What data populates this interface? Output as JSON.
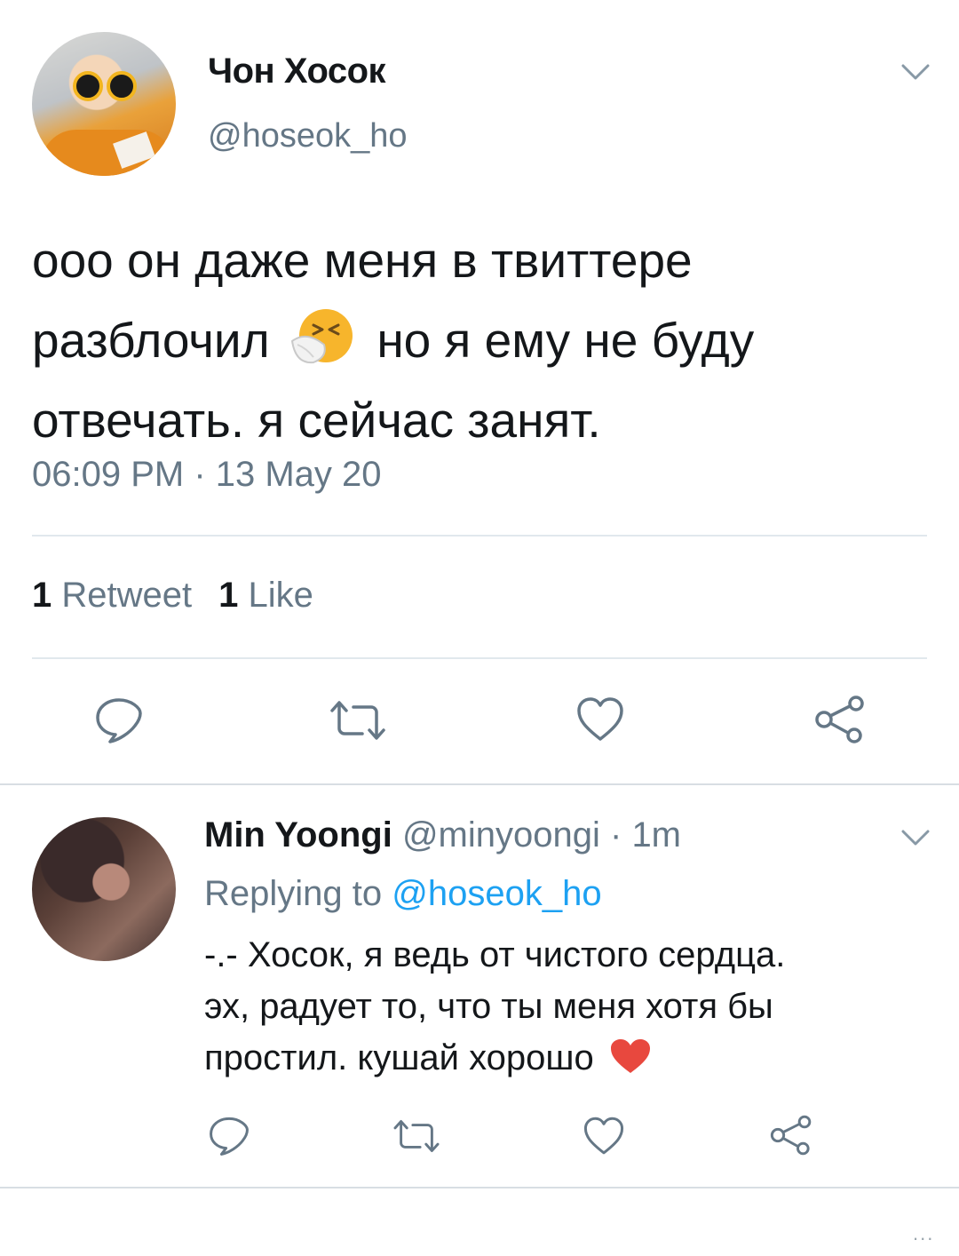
{
  "main_tweet": {
    "display_name": "Чон Хосок",
    "handle": "@hoseok_ho",
    "text_line1": "ооо он даже меня в твиттере",
    "text_line2a": "разблочил",
    "text_line2b": "но я ему не буду",
    "text_line3": "отвечать. я сейчас занят.",
    "emoji": "sneezing-face-emoji",
    "timestamp": "06:09 PM · 13 May 20",
    "retweet_count": "1",
    "retweet_label": "Retweet",
    "like_count": "1",
    "like_label": "Like"
  },
  "reply": {
    "display_name": "Min Yoongi",
    "handle": "@minyoongi",
    "time": " · 1m",
    "replying_prefix": "Replying to ",
    "replying_mention": "@hoseok_ho",
    "text_line1": "-.- Хосок, я ведь от чистого сердца.",
    "text_line2": "эх, радует то, что ты меня хотя бы",
    "text_line3": "простил. кушай хорошо",
    "emoji": "red-heart-emoji"
  },
  "footer": {
    "more": "..."
  },
  "colors": {
    "text_primary": "#14171a",
    "text_secondary": "#657786",
    "link": "#1da1f2",
    "divider": "#e1e8ed",
    "heart": "#e0245e"
  }
}
